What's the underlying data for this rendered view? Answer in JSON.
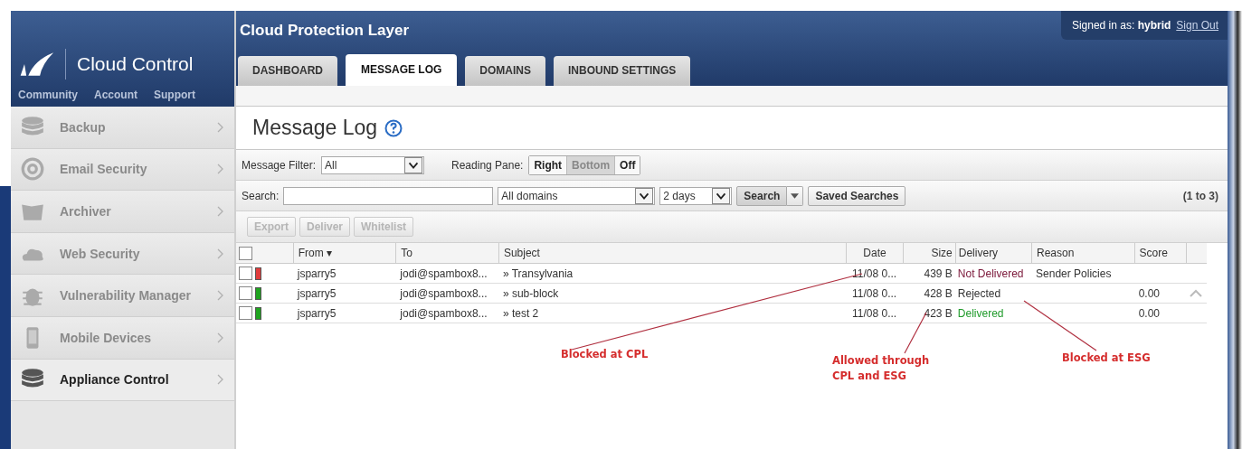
{
  "brand": {
    "name": "Cloud Control",
    "links": [
      "Community",
      "Account",
      "Support"
    ]
  },
  "header": {
    "title": "Cloud Protection Layer",
    "signed_in_label": "Signed in as:",
    "user": "hybrid",
    "sign_out": "Sign Out"
  },
  "tabs": [
    {
      "label": "DASHBOARD",
      "selected": false
    },
    {
      "label": "MESSAGE LOG",
      "selected": true
    },
    {
      "label": "DOMAINS",
      "selected": false
    },
    {
      "label": "INBOUND SETTINGS",
      "selected": false
    }
  ],
  "sidebar": {
    "items": [
      {
        "label": "Backup",
        "kind": "disks",
        "selected": false
      },
      {
        "label": "Email Security",
        "kind": "at",
        "selected": false
      },
      {
        "label": "Archiver",
        "kind": "folder",
        "selected": false
      },
      {
        "label": "Web Security",
        "kind": "cloud",
        "selected": false
      },
      {
        "label": "Vulnerability Manager",
        "kind": "bug",
        "selected": false
      },
      {
        "label": "Mobile Devices",
        "kind": "phone",
        "selected": false
      },
      {
        "label": "Appliance Control",
        "kind": "disks",
        "selected": true
      }
    ]
  },
  "page": {
    "title": "Message Log"
  },
  "filter": {
    "label": "Message Filter:",
    "value": "All",
    "reading_pane_label": "Reading Pane:",
    "reading_pane": [
      {
        "label": "Right",
        "selected": false
      },
      {
        "label": "Bottom",
        "selected": true
      },
      {
        "label": "Off",
        "selected": false
      }
    ]
  },
  "search": {
    "label": "Search:",
    "domain": "All domains",
    "range": "2 days",
    "search_button": "Search",
    "saved_button": "Saved Searches",
    "count": "(1 to 3)"
  },
  "actions": [
    {
      "label": "Export",
      "disabled": true
    },
    {
      "label": "Deliver",
      "disabled": true
    },
    {
      "label": "Whitelist",
      "disabled": true
    }
  ],
  "table": {
    "select_all_checked": false,
    "columns": [
      "From ▾",
      "To",
      "Subject",
      "Date",
      "Size",
      "Delivery",
      "Reason",
      "Score"
    ],
    "rows": [
      {
        "checked": false,
        "color": "#e03c3c",
        "from": "jsparry5",
        "to": "jodi@spambox8...",
        "subject": "» Transylvania",
        "date": "11/08 0...",
        "size": "439 B",
        "delivery": {
          "text": "Not Delivered",
          "color": "#7a1638"
        },
        "reason": "Sender Policies"
      },
      {
        "checked": false,
        "color": "#1fa31f",
        "from": "jsparry5",
        "to": "jodi@spambox8...",
        "subject": "» sub-block",
        "date": "11/08 0...",
        "size": "428 B",
        "delivery": {
          "text": "Rejected",
          "color": "#333333"
        },
        "score": "0.00"
      },
      {
        "checked": false,
        "color": "#1fa31f",
        "from": "jsparry5",
        "to": "jodi@spambox8...",
        "subject": "» test 2",
        "date": "11/08 0...",
        "size": "423 B",
        "delivery": {
          "text": "Delivered",
          "color": "#1f9a2a"
        },
        "score": "0.00"
      }
    ]
  },
  "annotations": [
    "Blocked at CPL",
    "Allowed through CPL and ESG",
    "Blocked at ESG"
  ]
}
